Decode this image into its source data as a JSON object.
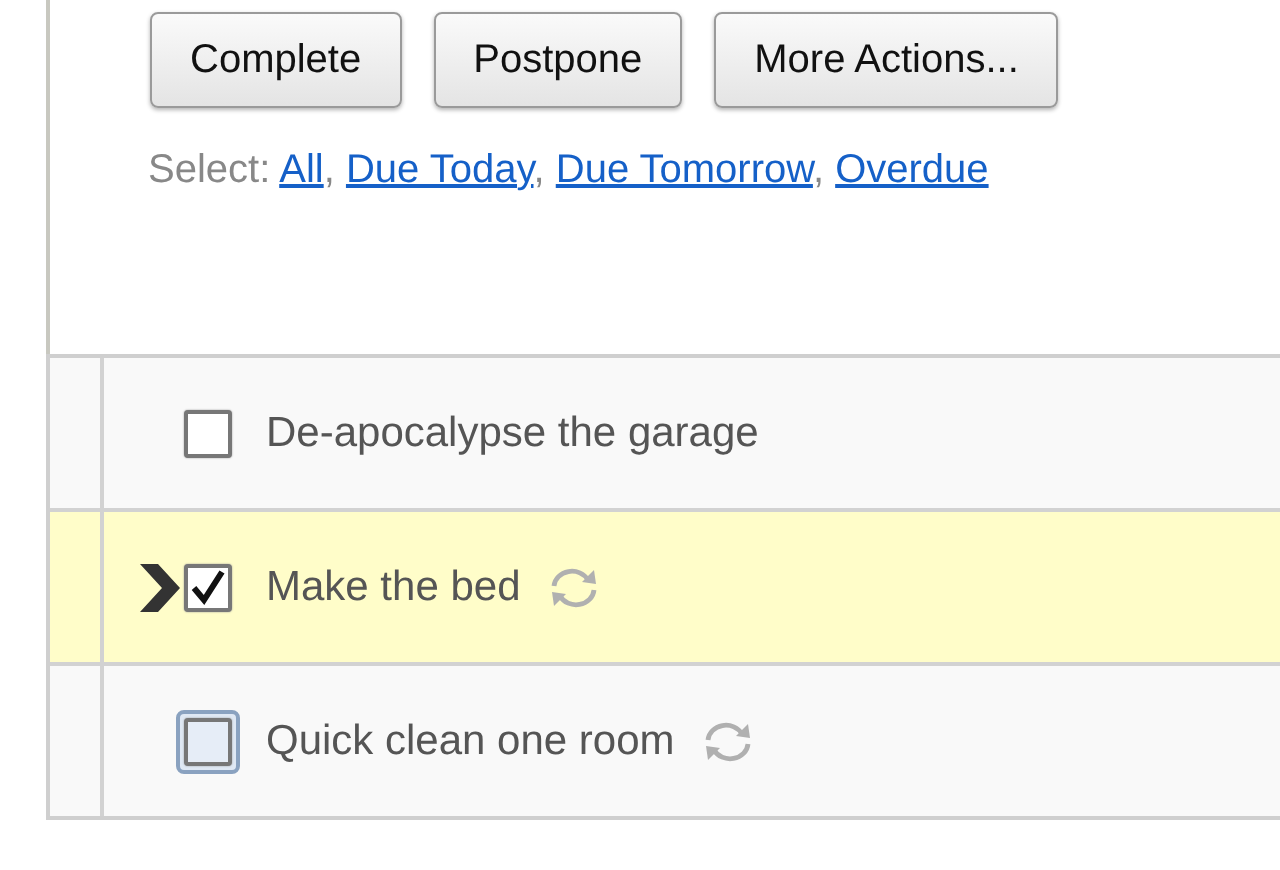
{
  "actions": [
    {
      "label": "Complete"
    },
    {
      "label": "Postpone"
    },
    {
      "label": "More Actions..."
    }
  ],
  "select": {
    "label": "Select:",
    "separator": ",",
    "links": [
      {
        "label": "All"
      },
      {
        "label": "Due Today"
      },
      {
        "label": "Due Tomorrow"
      },
      {
        "label": "Overdue"
      }
    ]
  },
  "tasks": [
    {
      "title": "De-apocalypse the garage",
      "checked": false,
      "selected": false,
      "focused": false,
      "repeating": false
    },
    {
      "title": "Make the bed",
      "checked": true,
      "selected": true,
      "focused": false,
      "repeating": true
    },
    {
      "title": "Quick clean one room",
      "checked": false,
      "selected": false,
      "focused": true,
      "repeating": true
    }
  ]
}
